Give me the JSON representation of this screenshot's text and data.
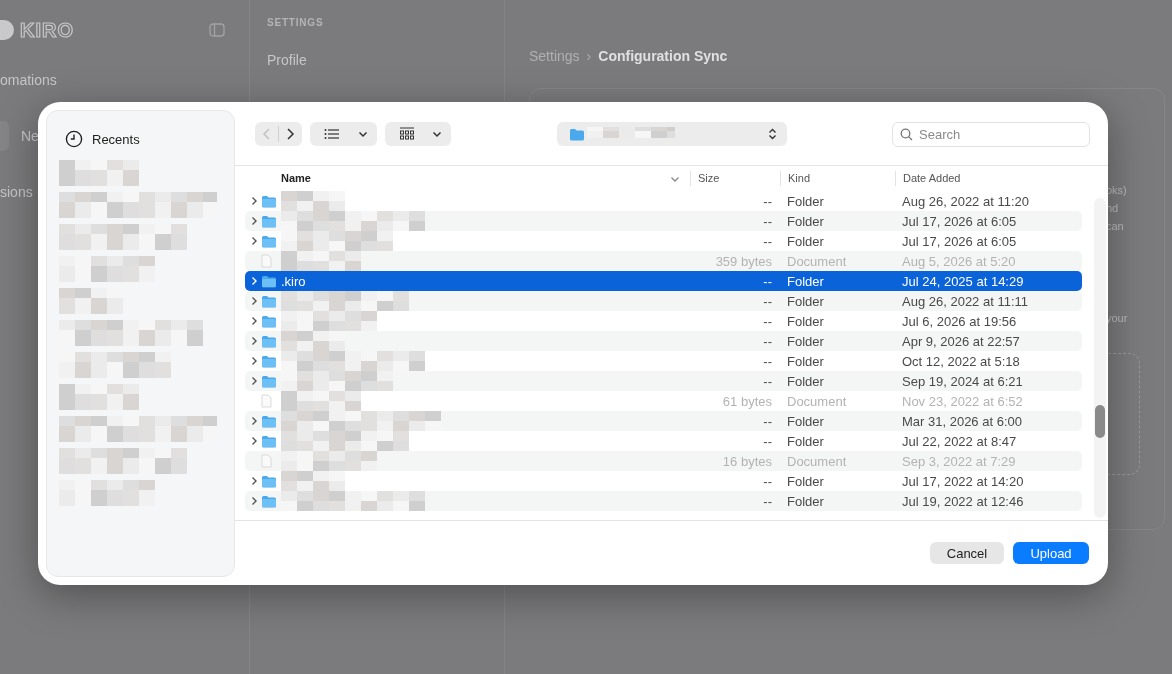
{
  "background": {
    "sidebar": {
      "logo": "KIRO",
      "items": [
        {
          "label": "omations",
          "kind": "link"
        },
        {
          "label": "Ne",
          "kind": "button"
        },
        {
          "label": "sions",
          "kind": "link"
        }
      ]
    },
    "settings_nav": {
      "heading": "SETTINGS",
      "items": [
        "Profile"
      ]
    },
    "breadcrumb": {
      "parent": "Settings",
      "separator": "›",
      "current": "Configuration Sync"
    },
    "content_fragments": [
      "oks)",
      "nd",
      "can",
      "your"
    ]
  },
  "dialog": {
    "sidebar": {
      "items": [
        {
          "label": "Recents",
          "selected": false
        }
      ]
    },
    "search": {
      "placeholder": "Search"
    },
    "columns": [
      "Name",
      "Size",
      "Kind",
      "Date Added"
    ],
    "rows": [
      {
        "kind": "folder",
        "size": "--",
        "type": "Folder",
        "date": "Aug 26, 2022 at 11:20",
        "selected": false
      },
      {
        "kind": "folder",
        "size": "--",
        "type": "Folder",
        "date": "Jul 17, 2026 at 6:05",
        "selected": false
      },
      {
        "kind": "folder",
        "size": "--",
        "type": "Folder",
        "date": "Jul 17, 2026 at 6:05",
        "selected": false
      },
      {
        "kind": "document",
        "size": "359 bytes",
        "type": "Document",
        "date": "Aug 5, 2026 at 5:20",
        "selected": false
      },
      {
        "kind": "folder",
        "name": ".kiro",
        "size": "--",
        "type": "Folder",
        "date": "Jul 24, 2025 at 14:29",
        "selected": true
      },
      {
        "kind": "folder",
        "size": "--",
        "type": "Folder",
        "date": "Aug 26, 2022 at 11:11",
        "selected": false
      },
      {
        "kind": "folder",
        "size": "--",
        "type": "Folder",
        "date": "Jul 6, 2026 at 19:56",
        "selected": false
      },
      {
        "kind": "folder",
        "size": "--",
        "type": "Folder",
        "date": "Apr 9, 2026 at 22:57",
        "selected": false
      },
      {
        "kind": "folder",
        "size": "--",
        "type": "Folder",
        "date": "Oct 12, 2022 at 5:18",
        "selected": false
      },
      {
        "kind": "folder",
        "size": "--",
        "type": "Folder",
        "date": "Sep 19, 2024 at 6:21",
        "selected": false
      },
      {
        "kind": "document",
        "size": "61 bytes",
        "type": "Document",
        "date": "Nov 23, 2022 at 6:52",
        "selected": false
      },
      {
        "kind": "folder",
        "size": "--",
        "type": "Folder",
        "date": "Mar 31, 2026 at 6:00",
        "selected": false
      },
      {
        "kind": "folder",
        "size": "--",
        "type": "Folder",
        "date": "Jul 22, 2022 at 8:47",
        "selected": false
      },
      {
        "kind": "document",
        "size": "16 bytes",
        "type": "Document",
        "date": "Sep 3, 2022 at 7:29",
        "selected": false
      },
      {
        "kind": "folder",
        "size": "--",
        "type": "Folder",
        "date": "Jul 17, 2022 at 14:20",
        "selected": false
      },
      {
        "kind": "folder",
        "size": "--",
        "type": "Folder",
        "date": "Jul 19, 2022 at 12:46",
        "selected": false
      }
    ],
    "buttons": [
      {
        "label": "Cancel",
        "kind": "secondary"
      },
      {
        "label": "Upload",
        "kind": "primary"
      }
    ]
  }
}
